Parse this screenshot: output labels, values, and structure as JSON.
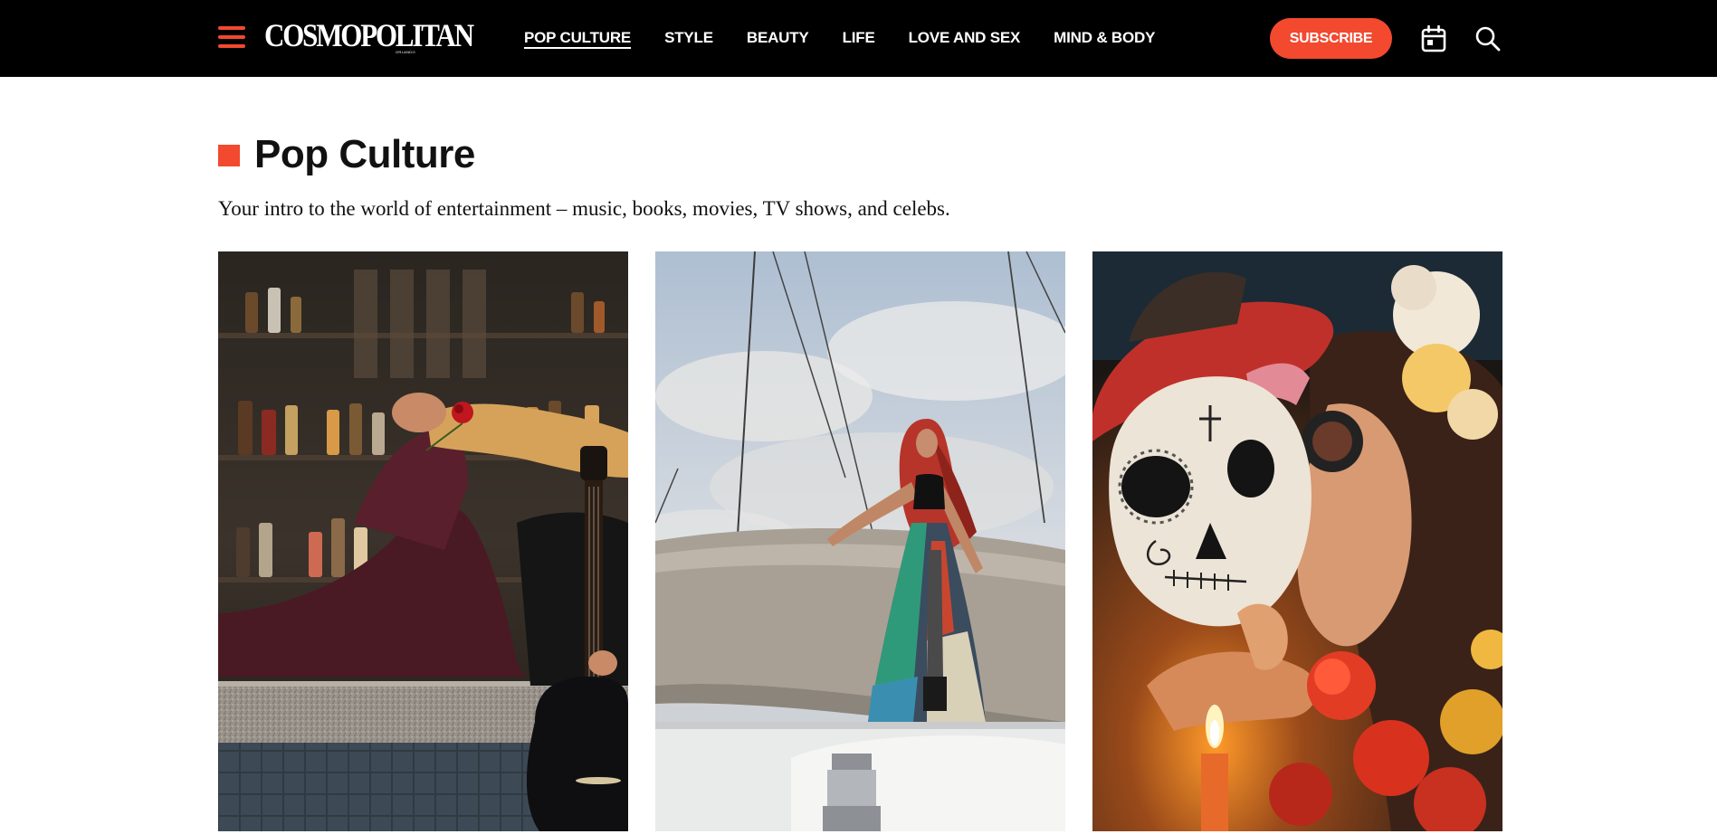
{
  "header": {
    "logo_text": "COSMOPOLITAN",
    "logo_subtext": "ORLANDO",
    "nav": [
      {
        "label": "POP CULTURE",
        "active": true
      },
      {
        "label": "STYLE",
        "active": false
      },
      {
        "label": "BEAUTY",
        "active": false
      },
      {
        "label": "LIFE",
        "active": false
      },
      {
        "label": "LOVE AND SEX",
        "active": false
      },
      {
        "label": "MIND & BODY",
        "active": false
      }
    ],
    "subscribe_label": "SUBSCRIBE",
    "icons": {
      "menu": "hamburger-menu-icon",
      "calendar": "calendar-icon",
      "search": "search-icon"
    }
  },
  "section": {
    "title": "Pop Culture",
    "intro": "Your intro to the world of entertainment – music, books, movies, TV shows, and celebs."
  },
  "colors": {
    "accent": "#f2492f",
    "header_bg": "#000000",
    "text": "#111111"
  },
  "cards": [
    {
      "image": "man-with-guitar-at-bar-photo"
    },
    {
      "image": "red-haired-woman-on-sailboat-photo"
    },
    {
      "image": "day-of-the-dead-couple-photo"
    }
  ]
}
